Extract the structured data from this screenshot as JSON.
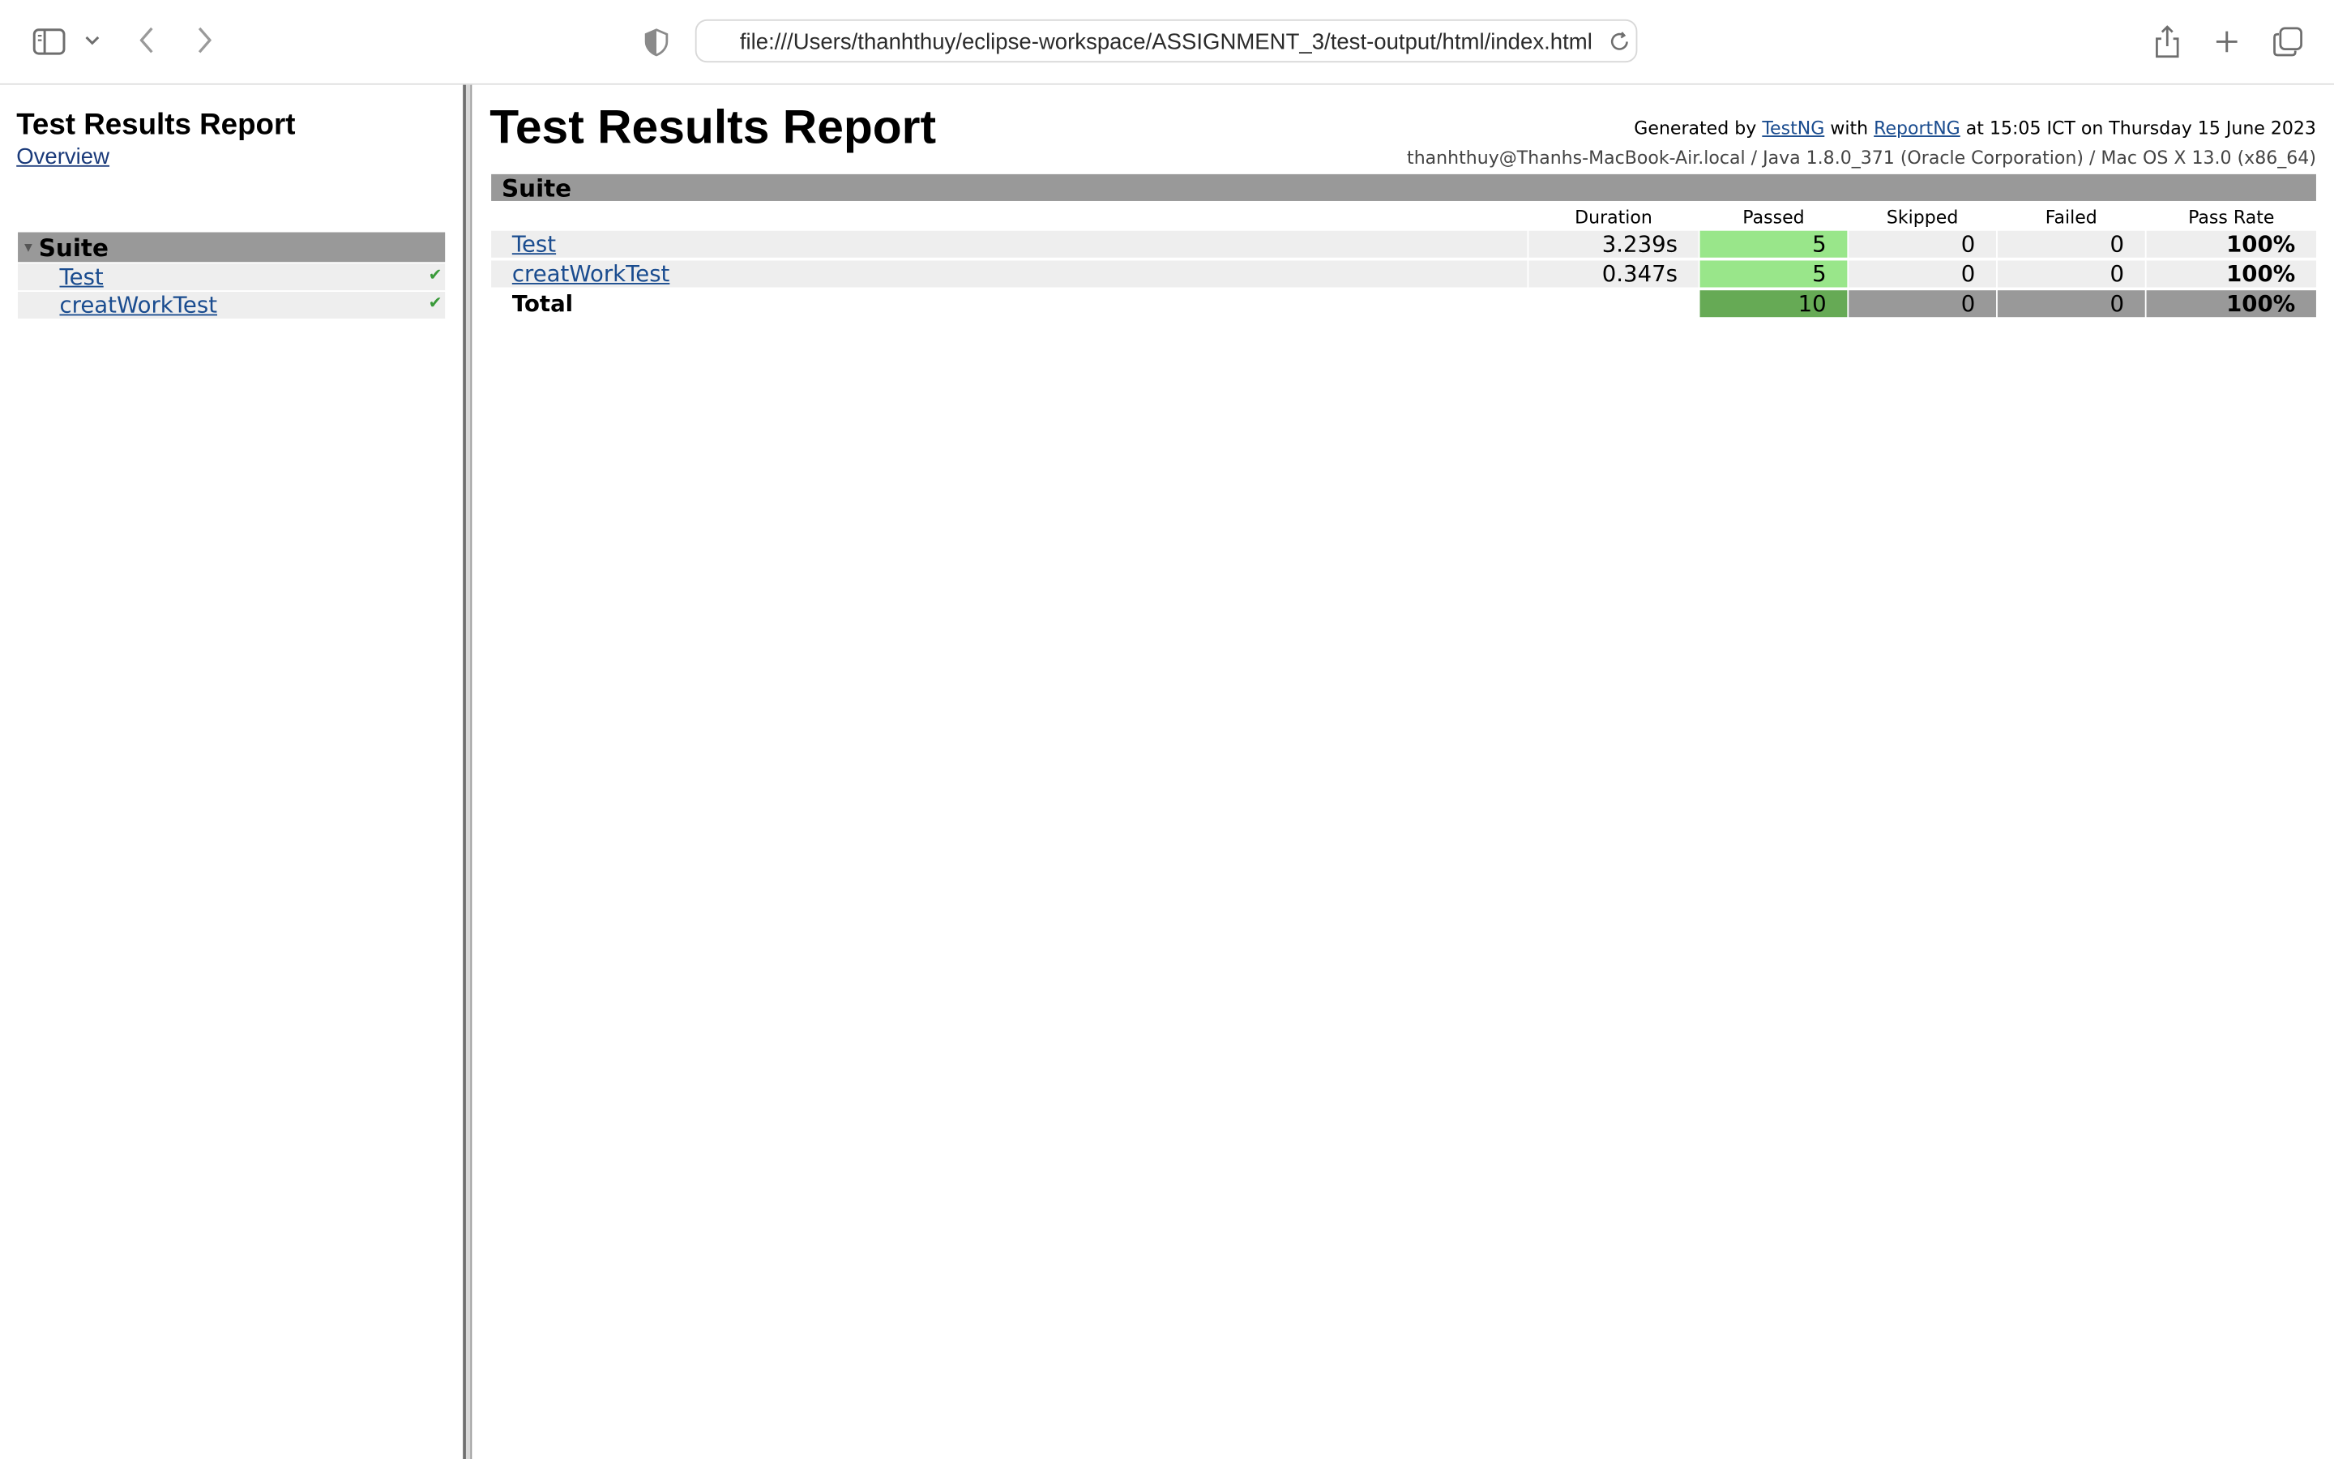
{
  "browser": {
    "url": "file:///Users/thanhthuy/eclipse-workspace/ASSIGNMENT_3/test-output/html/index.html"
  },
  "nav": {
    "title": "Test Results Report",
    "overview_link": "Overview",
    "suite_label": "Suite",
    "tests": [
      {
        "label": "Test",
        "status": "✔"
      },
      {
        "label": "creatWorkTest",
        "status": "✔"
      }
    ]
  },
  "main": {
    "title": "Test Results Report",
    "generated": {
      "prefix": "Generated by",
      "tool1": "TestNG",
      "with": "with",
      "tool2": "ReportNG",
      "suffix": "at 15:05 ICT on Thursday 15 June 2023"
    },
    "system_info": "thanhthuy@Thanhs-MacBook-Air.local / Java 1.8.0_371 (Oracle Corporation) / Mac OS X 13.0 (x86_64)",
    "suite_label": "Suite",
    "columns": {
      "duration": "Duration",
      "passed": "Passed",
      "skipped": "Skipped",
      "failed": "Failed",
      "pass_rate": "Pass Rate"
    },
    "rows": [
      {
        "name": "Test",
        "duration": "3.239s",
        "passed": "5",
        "skipped": "0",
        "failed": "0",
        "pass_rate": "100%"
      },
      {
        "name": "creatWorkTest",
        "duration": "0.347s",
        "passed": "5",
        "skipped": "0",
        "failed": "0",
        "pass_rate": "100%"
      }
    ],
    "total": {
      "label": "Total",
      "passed": "10",
      "skipped": "0",
      "failed": "0",
      "pass_rate": "100%"
    }
  },
  "colors": {
    "passed": "#99e68a",
    "passed_total": "#66aa55",
    "header_grey": "#999999",
    "row_grey": "#eeeeee",
    "link": "#1a4c8f"
  }
}
